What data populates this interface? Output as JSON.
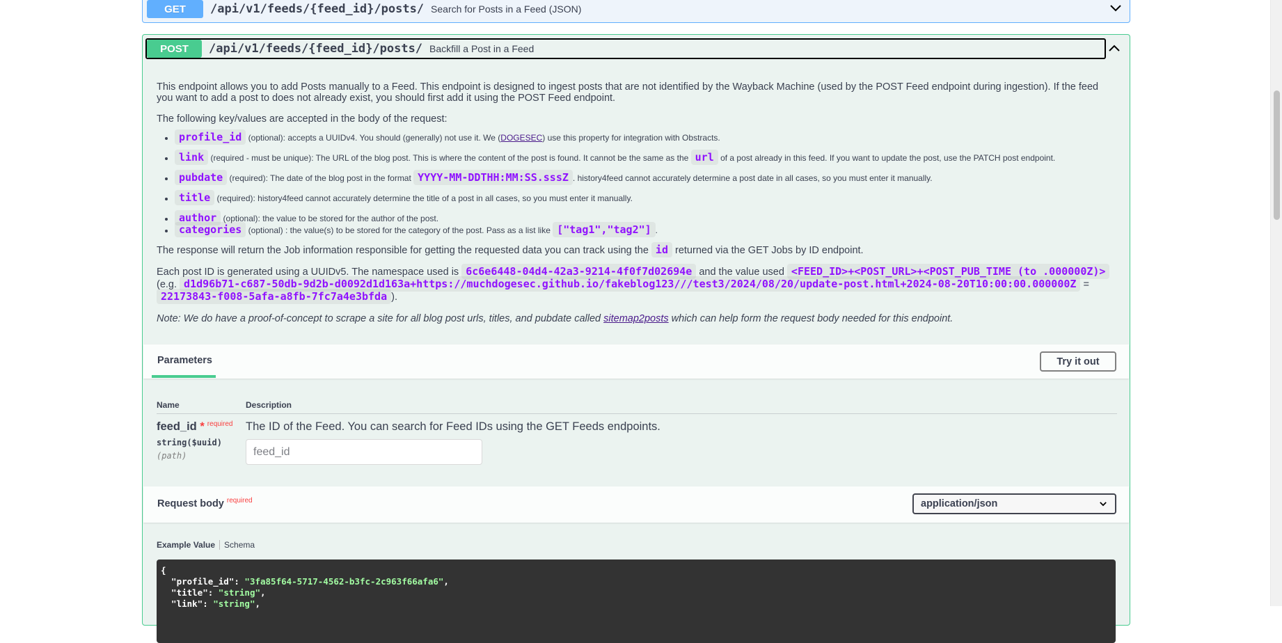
{
  "get_op": {
    "method": "GET",
    "path": "/api/v1/feeds/{feed_id}/posts/",
    "summary": "Search for Posts in a Feed (JSON)"
  },
  "post_op": {
    "method": "POST",
    "path": "/api/v1/feeds/{feed_id}/posts/",
    "summary": "Backfill a Post in a Feed"
  },
  "description": {
    "intro": "This endpoint allows you to add Posts manually to a Feed. This endpoint is designed to ingest posts that are not identified by the Wayback Machine (used by the POST Feed endpoint during ingestion). If the feed you want to add a post to does not already exist, you should first add it using the POST Feed endpoint.",
    "kv_intro": "The following key/values are accepted in the body of the request:",
    "items": {
      "profile_id": {
        "key": "profile_id",
        "t1": " (optional): accepts a UUIDv4. You should (generally) not use it. We (",
        "link": "DOGESEC",
        "t2": ") use this property for integration with Obstracts."
      },
      "link": {
        "key": "link",
        "t1": " (required - must be unique): The URL of the blog post. This is where the content of the post is found. It cannot be the same as the ",
        "code": "url",
        "t2": " of a post already in this feed. If you want to update the post, use the PATCH post endpoint."
      },
      "pubdate": {
        "key": "pubdate",
        "t1": " (required): The date of the blog post in the format ",
        "code": "YYYY-MM-DDTHH:MM:SS.sssZ",
        "t2": ". history4feed cannot accurately determine a post date in all cases, so you must enter it manually."
      },
      "title": {
        "key": "title",
        "t1": " (required): history4feed cannot accurately determine the title of a post in all cases, so you must enter it manually."
      },
      "author": {
        "key": "author",
        "t1": " (optional): the value to be stored for the author of the post."
      },
      "categories": {
        "key": "categories",
        "t1": " (optional) : the value(s) to be stored for the category of the post. Pass as a list like ",
        "code": "[\"tag1\",\"tag2\"]",
        "t2": "."
      }
    },
    "response": {
      "t1": "The response will return the Job information responsible for getting the requested data you can track using the ",
      "code": "id",
      "t2": " returned via the GET Jobs by ID endpoint."
    },
    "uuid": {
      "t1": "Each post ID is generated using a UUIDv5. The namespace used is ",
      "ns": "6c6e6448-04d4-42a3-9214-4f0f7d02694e",
      "t2": " and the value used ",
      "val": "<FEED_ID>+<POST_URL>+<POST_PUB_TIME (to .000000Z)>",
      "t3": " (e.g. ",
      "ex": "d1d96b71-c687-50db-9d2b-d0092d1d163a+https://muchdogesec.github.io/fakeblog123///test3/2024/08/20/update-post.html+2024-08-20T10:00:00.000000Z",
      "t4": " = ",
      "res": "22173843-f008-5afa-a8fb-7fc7a4e3bfda",
      "t5": ")."
    },
    "note": {
      "t1": "Note: We do have a proof-of-concept to scrape a site for all blog post urls, titles, and pubdate called ",
      "link": "sitemap2posts",
      "t2": " which can help form the request body needed for this endpoint."
    }
  },
  "parameters": {
    "tab_label": "Parameters",
    "try_button": "Try it out",
    "col_name": "Name",
    "col_desc": "Description",
    "param": {
      "name": "feed_id",
      "star": "*",
      "required": "required",
      "type": "string($uuid)",
      "in": "(path)",
      "description": "The ID of the Feed. You can search for Feed IDs using the GET Feeds endpoints.",
      "placeholder": "feed_id"
    }
  },
  "request_body": {
    "title": "Request body",
    "required": "required",
    "content_type": "application/json",
    "tab_example": "Example Value",
    "tab_schema": "Schema",
    "code": {
      "open": "{",
      "l1_key": "  \"profile_id\": ",
      "l1_val": "\"3fa85f64-5717-4562-b3fc-2c963f66afa6\"",
      "l2_key": "  \"title\": ",
      "l2_val": "\"string\"",
      "l3_key": "  \"link\": ",
      "l3_val": "\"string\"",
      "comma": ","
    }
  },
  "colors": {
    "get": "#61affe",
    "post": "#49cc90",
    "code_accent": "#9012fe",
    "required": "#f93e3e"
  }
}
